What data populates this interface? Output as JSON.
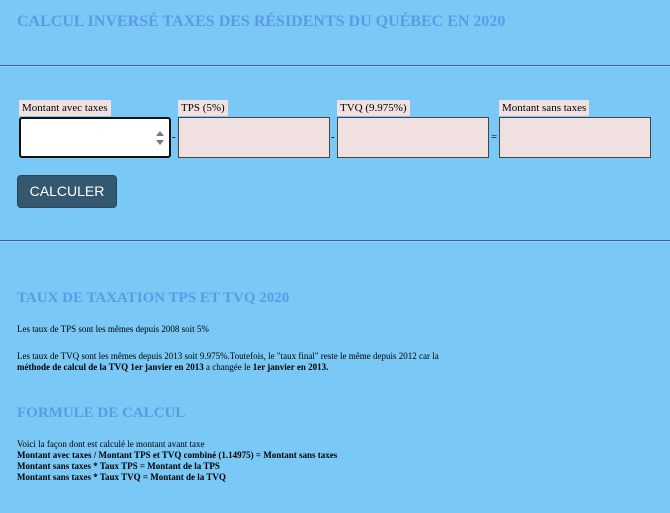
{
  "header": {
    "title": "CALCUL INVERSÉ TAXES DES RÉSIDENTS DU QUÉBEC EN 2020"
  },
  "calculator": {
    "fields": [
      {
        "label": "Montant avec taxes",
        "value": ""
      },
      {
        "label": "TPS (5%)",
        "value": ""
      },
      {
        "label": "TVQ (9.975%)",
        "value": ""
      },
      {
        "label": "Montant sans taxes",
        "value": ""
      }
    ],
    "operators": [
      "-",
      "-",
      "="
    ],
    "button_label": "CALCULER"
  },
  "rates_section": {
    "title": "TAUX DE TAXATION TPS ET TVQ 2020",
    "tps_text": "Les taux de TPS sont les mêmes depuis 2008 soit 5%",
    "tvq_line1": "Les taux de TVQ sont les mêmes depuis 2013 soit 9.975%.Toutefois, le \"taux final\" reste le même depuis 2012 car la",
    "tvq_line2_bold1": "méthode de calcul de la TVQ 1er janvier en 2013",
    "tvq_line2_plain": " a changée le ",
    "tvq_line2_bold2": "1er janvier en 2013."
  },
  "formula_section": {
    "title": "FORMULE DE CALCUL",
    "intro": "Voici la façon dont est calculé le montant avant taxe",
    "lines": [
      "Montant avec taxes / Montant TPS et TVQ combiné (1.14975) = Montant sans taxes",
      "Montant sans taxes * Taux TPS = Montant de la TPS",
      "Montant sans taxes * Taux TVQ = Montant de la TVQ"
    ]
  }
}
